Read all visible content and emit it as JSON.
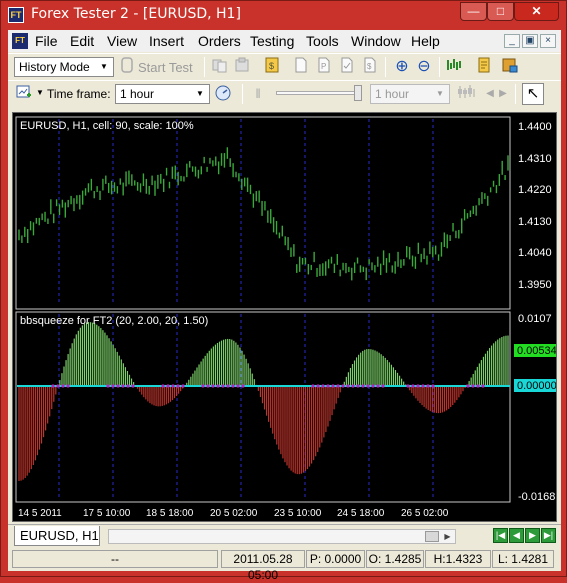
{
  "window": {
    "title": "Forex Tester 2 - [EURUSD, H1]",
    "app_icon": "FT",
    "min_glyph": "—",
    "max_glyph": "□",
    "close_glyph": "✕"
  },
  "menu": {
    "items": [
      "File",
      "Edit",
      "View",
      "Insert",
      "Orders",
      "Testing",
      "Tools",
      "Window",
      "Help"
    ],
    "mdi_min": "_",
    "mdi_restore": "▣",
    "mdi_close": "×"
  },
  "toolbar1": {
    "mode_select": "History Mode",
    "start_test": "Start Test"
  },
  "toolbar2": {
    "timeframe_label": "Time frame:",
    "timeframe_value": "1 hour",
    "speed_value": "1 hour"
  },
  "chart": {
    "header": "EURUSD, H1, cell: 90, scale: 100%",
    "price_ticks": [
      "1.4400",
      "1.4310",
      "1.4220",
      "1.4130",
      "1.4040",
      "1.3950"
    ],
    "indicator_header": "bbsqueeze for FT2 (20, 2.00, 20, 1.50)",
    "indicator_ticks": [
      "0.0107",
      "-0.0168"
    ],
    "indicator_current": "0.00534",
    "indicator_zero": "0.00000",
    "time_labels": [
      "14 5 2011",
      "17 5 10:00",
      "18 5 18:00",
      "20 5 02:00",
      "23 5 10:00",
      "24 5 18:00",
      "26 5 02:00"
    ],
    "colors": {
      "price": "#3aa83a",
      "hist_pos": "#7cd26a",
      "hist_neg": "#c0342c",
      "zero_line": "#19d7d7",
      "squeeze_dot": "#c020c0",
      "grid": "#2a2ad0",
      "current_box": "#22dd22",
      "zero_box": "#19d7d7"
    }
  },
  "chart_data": {
    "type": "line",
    "title": "EURUSD, H1, cell: 90, scale: 100%",
    "x": [
      "14 5 2011",
      "17 5 10:00",
      "18 5 18:00",
      "20 5 02:00",
      "23 5 10:00",
      "24 5 18:00",
      "26 5 02:00"
    ],
    "series": [
      {
        "name": "EURUSD",
        "values": [
          1.412,
          1.423,
          1.425,
          1.431,
          1.405,
          1.404,
          1.408,
          1.428
        ]
      },
      {
        "name": "bbsqueeze for FT2 (20, 2.00, 20, 1.50)",
        "values": [
          -0.014,
          0.0095,
          -0.003,
          0.007,
          -0.013,
          0.0055,
          -0.004,
          0.0075
        ]
      }
    ],
    "ylim": [
      1.395,
      1.44
    ],
    "indicator_ylim": [
      -0.0168,
      0.0107
    ]
  },
  "tabs": {
    "active": "EURUSD, H1"
  },
  "status": {
    "empty": "--",
    "date": "2011.05.28 05:00",
    "p": "P: 0.0000",
    "o": "O: 1.4285",
    "h": "H:1.4323",
    "l": "L: 1.4281"
  },
  "icons": {
    "arrow_down": "▼",
    "arrow_left": "◀",
    "arrow_right": "▶",
    "first": "|◀",
    "last": "▶|",
    "cursor": "↖",
    "pause": "‖",
    "zoom_in": "⊕",
    "zoom_out": "⊖"
  }
}
